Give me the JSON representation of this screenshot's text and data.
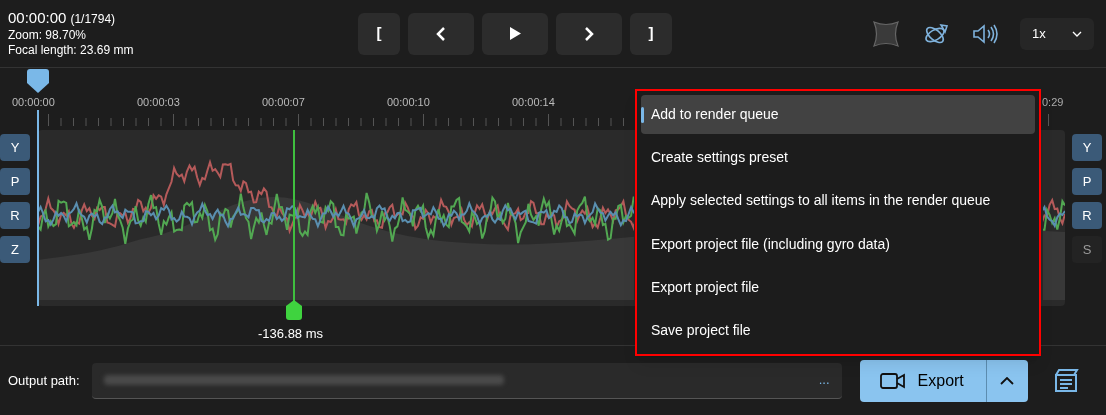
{
  "header": {
    "timecode": "00:00:00",
    "frame": "(1/1794)",
    "zoom": "Zoom: 98.70%",
    "focal_length": "Focal length: 23.69 mm"
  },
  "transport": [
    "[",
    "]"
  ],
  "speed": {
    "value": "1x"
  },
  "timeline": {
    "ticks": [
      "00:00:00",
      "00:00:03",
      "00:00:07",
      "00:00:10",
      "00:00:14",
      "0:29"
    ],
    "left_toggles": [
      {
        "label": "Y",
        "on": true
      },
      {
        "label": "P",
        "on": true
      },
      {
        "label": "R",
        "on": true
      },
      {
        "label": "Z",
        "on": true
      }
    ],
    "right_toggles": [
      {
        "label": "Y",
        "on": true
      },
      {
        "label": "P",
        "on": true
      },
      {
        "label": "R",
        "on": true
      },
      {
        "label": "S",
        "on": false
      }
    ],
    "marker": {
      "label": "-136.88 ms"
    }
  },
  "menu": [
    {
      "label": "Add to render queue",
      "selected": true
    },
    {
      "label": "Create settings preset",
      "selected": false
    },
    {
      "label": "Apply selected settings to all items in the render queue",
      "selected": false
    },
    {
      "label": "Export project file (including gyro data)",
      "selected": false
    },
    {
      "label": "Export project file",
      "selected": false
    },
    {
      "label": "Save project file",
      "selected": false
    }
  ],
  "output": {
    "label": "Output path:",
    "browse": "...",
    "export": "Export"
  }
}
